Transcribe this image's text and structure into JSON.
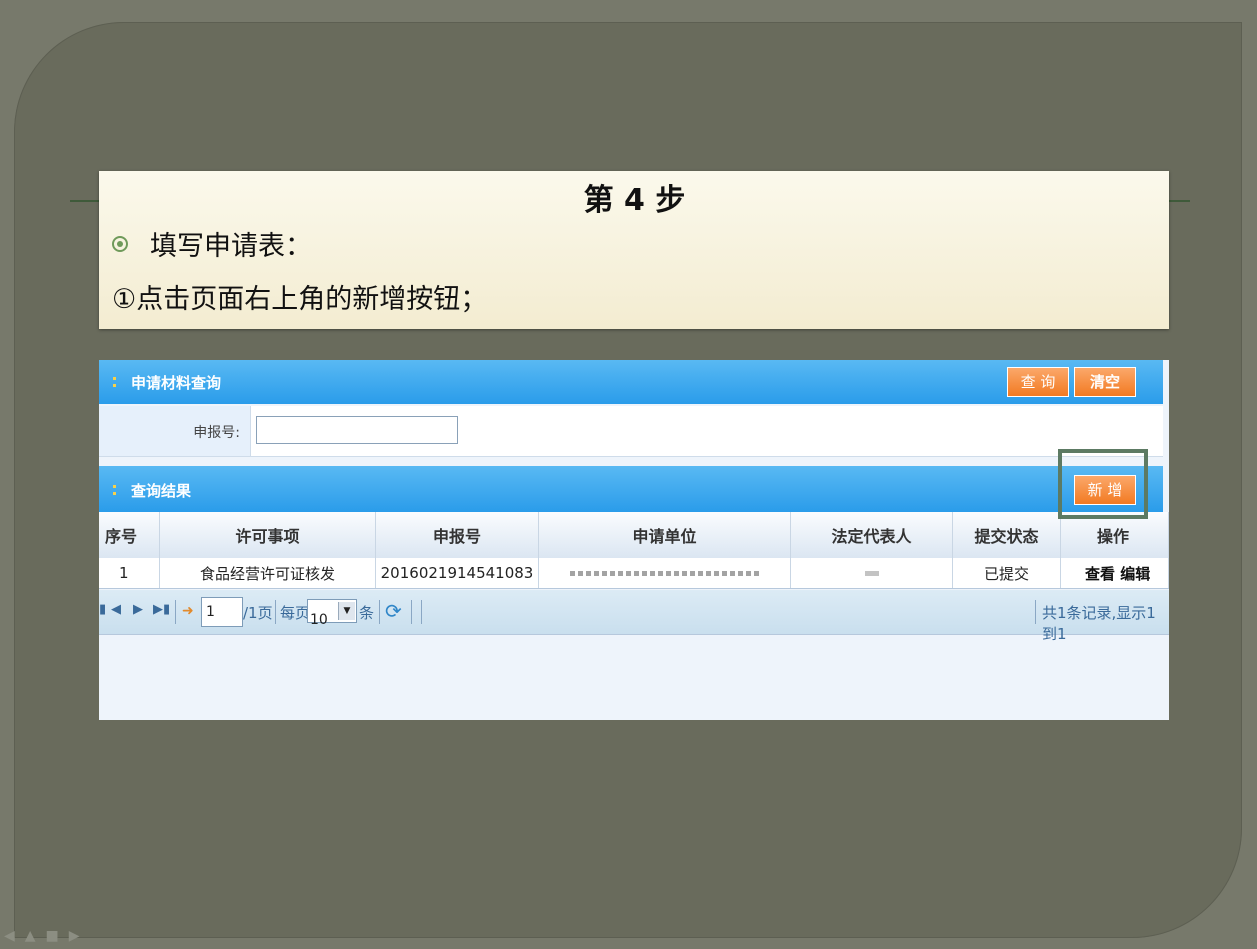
{
  "slide": {
    "title": "第 4 步",
    "bullet": "填写申请表：",
    "step": "①点击页面右上角的新增按钮；"
  },
  "search_panel": {
    "title": "申请材料查询",
    "query_button": "查 询",
    "clear_button": "清空",
    "field_label": "申报号:",
    "field_value": ""
  },
  "results_panel": {
    "title": "查询结果",
    "add_button": "新 增"
  },
  "table": {
    "columns": [
      "序号",
      "许可事项",
      "申报号",
      "申请单位",
      "法定代表人",
      "提交状态",
      "操作"
    ],
    "rows": [
      {
        "index": "1",
        "item": "食品经营许可证核发",
        "report_no": "2016021914541083",
        "unit": "",
        "legal_rep": "",
        "status": "已提交",
        "view": "查看",
        "edit": "编辑"
      }
    ]
  },
  "pager": {
    "current_page": "1",
    "total_pages": "/1页",
    "per_page_label": "每页",
    "per_page_value": "10",
    "per_page_suffix": "条",
    "summary": "共1条记录,显示1到1"
  },
  "colors": {
    "bar_blue": "#2a9cea",
    "button_orange": "#f27a22",
    "highlight_green": "#5c7a63"
  }
}
